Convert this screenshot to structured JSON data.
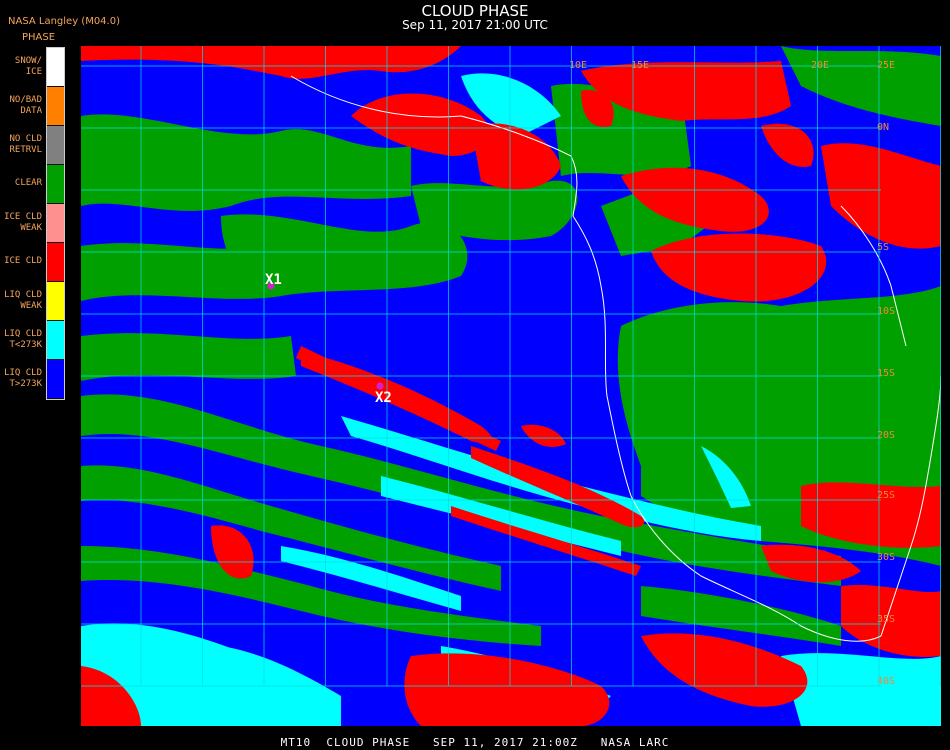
{
  "header": {
    "agency": "NASA Langley (M04.0)",
    "legend_title": "PHASE",
    "title": "CLOUD PHASE",
    "subtitle": "Sep 11, 2017 21:00 UTC"
  },
  "legend": [
    {
      "label": "SNOW/\nICE",
      "color": "#ffffff"
    },
    {
      "label": "NO/BAD\nDATA",
      "color": "#ff8000"
    },
    {
      "label": "NO CLD\nRETRVL",
      "color": "#808080"
    },
    {
      "label": "CLEAR",
      "color": "#00a000"
    },
    {
      "label": "ICE CLD\nWEAK",
      "color": "#ff9090"
    },
    {
      "label": "ICE CLD",
      "color": "#ff0000"
    },
    {
      "label": "LIQ CLD\nWEAK",
      "color": "#ffff00"
    },
    {
      "label": "LIQ CLD\nT<273K",
      "color": "#00ffff"
    },
    {
      "label": "LIQ CLD\nT>273K",
      "color": "#0000ff"
    }
  ],
  "markers": [
    {
      "label": "X1",
      "color": "#d020d0"
    },
    {
      "label": "X2",
      "color": "#d020d0"
    }
  ],
  "grid_labels": {
    "top": [
      "10E",
      "15E",
      "20E",
      "25E"
    ],
    "right": [
      "0N",
      "5S",
      "10S",
      "15S",
      "20S",
      "25S",
      "30S",
      "35S",
      "40S"
    ]
  },
  "footer": "MT10  CLOUD PHASE   SEP 11, 2017 21:00Z   NASA LARC"
}
